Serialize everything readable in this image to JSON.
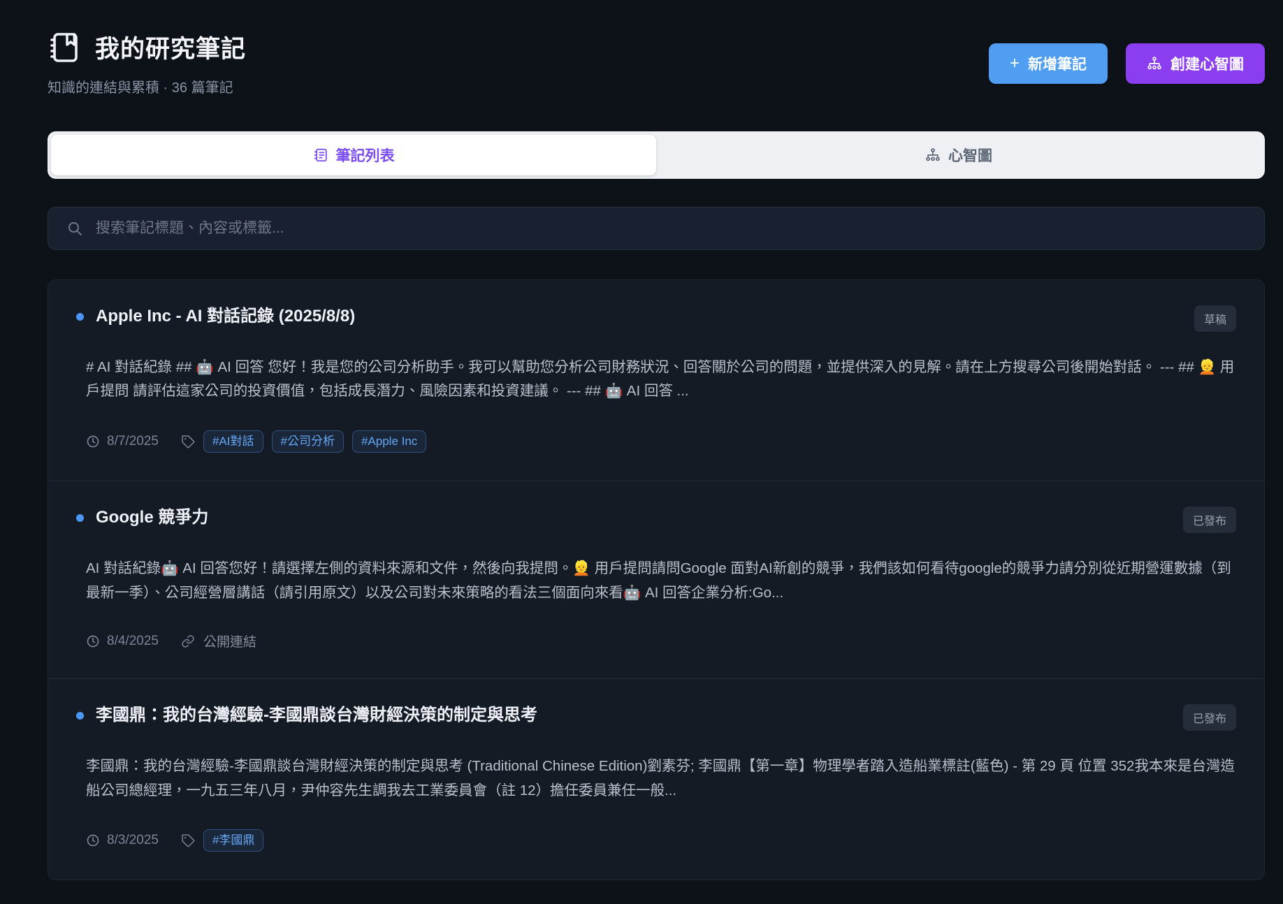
{
  "header": {
    "title": "我的研究筆記",
    "subtitle": "知識的連結與累積 · 36 篇筆記",
    "new_note_label": "新增筆記",
    "create_mindmap_label": "創建心智圖"
  },
  "icons": {
    "plus": "+"
  },
  "tabs": [
    {
      "label": "筆記列表",
      "active": true
    },
    {
      "label": "心智圖",
      "active": false
    }
  ],
  "search": {
    "placeholder": "搜索筆記標題、內容或標籤..."
  },
  "notes": [
    {
      "title": "Apple Inc - AI 對話記錄 (2025/8/8)",
      "status": "草稿",
      "preview": "# AI 對話紀錄 ## 🤖 AI 回答 您好！我是您的公司分析助手。我可以幫助您分析公司財務狀況、回答關於公司的問題，並提供深入的見解。請在上方搜尋公司後開始對話。 --- ## 👱 用戶提問 請評估這家公司的投資價值，包括成長潛力、風險因素和投資建議。 --- ## 🤖 AI 回答 ...",
      "date": "8/7/2025",
      "tags": [
        "#AI對話",
        "#公司分析",
        "#Apple Inc"
      ]
    },
    {
      "title": "Google 競爭力",
      "status": "已發布",
      "preview": "AI 對話紀錄🤖 AI 回答您好！請選擇左側的資料來源和文件，然後向我提問。👱 用戶提問請問Google 面對AI新創的競爭，我們該如何看待google的競爭力請分別從近期營運數據（到最新一季）、公司經營層講話（請引用原文）以及公司對未來策略的看法三個面向來看🤖 AI 回答企業分析:Go...",
      "date": "8/4/2025",
      "link_label": "公開連結"
    },
    {
      "title": "李國鼎：我的台灣經驗-李國鼎談台灣財經決策的制定與思考",
      "status": "已發布",
      "preview": "李國鼎：我的台灣經驗-李國鼎談台灣財經決策的制定與思考 (Traditional Chinese Edition)劉素芬; 李國鼎【第一章】物理學者踏入造船業標註(藍色) - 第 29 頁 位置 352我本來是台灣造船公司總經理，一九五三年八月，尹仲容先生調我去工業委員會（註 12）擔任委員兼任一般...",
      "date": "8/3/2025",
      "tags": [
        "#李國鼎"
      ]
    }
  ],
  "colors": {
    "page_bg": "#0d1219",
    "card_bg": "#151b25",
    "accent_blue": "#4f9ef2",
    "accent_purple": "#8a3ef0",
    "active_tab_text": "#7b4cf0",
    "tag_blue": "#67a7f3",
    "bullet_blue": "#4b96f3"
  }
}
